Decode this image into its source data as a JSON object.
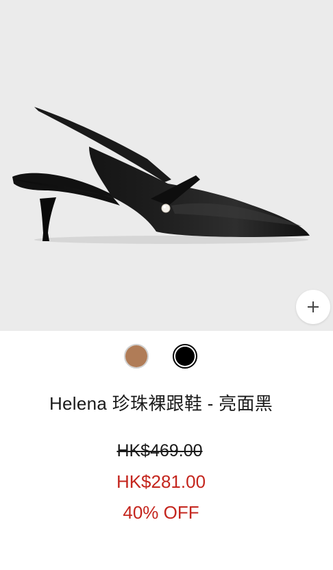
{
  "product": {
    "image_alt": "black pointed slingback kitten heel with pearl strap",
    "title": "Helena 珍珠裸跟鞋 - 亮面黑",
    "original_price": "HK$469.00",
    "sale_price": "HK$281.00",
    "discount": "40% OFF"
  },
  "zoom_button": {
    "icon": "plus-icon"
  },
  "color_options": [
    {
      "name": "tan",
      "hex": "#b07c57",
      "selected": false
    },
    {
      "name": "black",
      "hex": "#000000",
      "selected": true
    }
  ],
  "colors": {
    "image_background": "#ebebeb",
    "sale_red": "#c4251d",
    "text": "#1a1a1a"
  }
}
